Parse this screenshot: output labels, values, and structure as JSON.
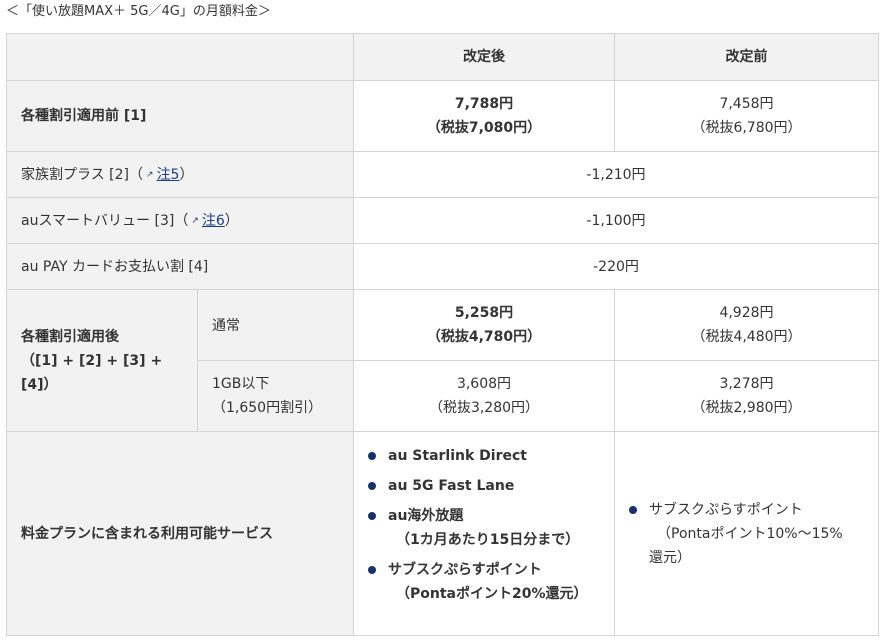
{
  "caption": "＜「使い放題MAX＋ 5G／4G」の月額料金＞",
  "header": {
    "after": "改定後",
    "before": "改定前"
  },
  "rows": {
    "pre_discount": {
      "label": "各種割引適用前 [1]",
      "after_price": "7,788円",
      "after_tax": "（税抜7,080円）",
      "before_price": "7,458円",
      "before_tax": "（税抜6,780円）"
    },
    "family": {
      "label_pre": "家族割プラス [2]（",
      "link": "注5",
      "label_post": "）",
      "value": "-1,210円"
    },
    "smart": {
      "label_pre": "auスマートバリュー [3]（",
      "link": "注6",
      "label_post": "）",
      "value": "-1,100円"
    },
    "paycard": {
      "label": "au PAY カードお支払い割 [4]",
      "value": "-220円"
    },
    "post_discount": {
      "label_line1": "各種割引適用後",
      "label_line2": "（[1] + [2] + [3] +",
      "label_line3": "[4]）",
      "normal": {
        "label": "通常",
        "after_price": "5,258円",
        "after_tax": "（税抜4,780円）",
        "before_price": "4,928円",
        "before_tax": "（税抜4,480円）"
      },
      "under1gb": {
        "label_line1": "1GB以下",
        "label_line2": "（1,650円割引）",
        "after_price": "3,608円",
        "after_tax": "（税抜3,280円）",
        "before_price": "3,278円",
        "before_tax": "（税抜2,980円）"
      }
    },
    "services": {
      "label": "料金プランに含まれる利用可能サービス",
      "after": [
        {
          "line1": "au Starlink Direct",
          "line2": ""
        },
        {
          "line1": "au 5G Fast Lane",
          "line2": ""
        },
        {
          "line1": "au海外放題",
          "line2": "（1カ月あたり15日分まで）"
        },
        {
          "line1": "サブスクぷらすポイント",
          "line2": "（Pontaポイント20%還元）"
        }
      ],
      "before": {
        "line1": "サブスクぷらすポイント",
        "line2": "（Pontaポイント10%～15%",
        "line3": "還元）"
      }
    }
  },
  "colors": {
    "header_bg": "#f2f2f2",
    "border": "#d4d4d4",
    "bullet": "#1a2f6e",
    "link": "#1d3d80"
  },
  "icons": {
    "external_link": "external-link-icon",
    "bullet": "bullet-icon"
  }
}
